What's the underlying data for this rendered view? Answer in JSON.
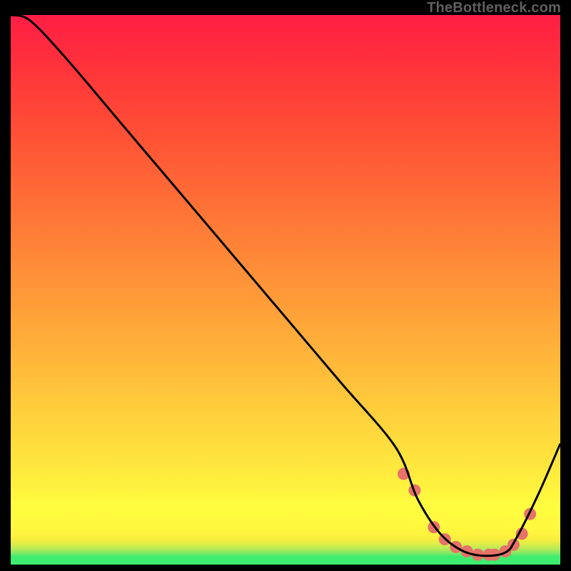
{
  "watermark": "TheBottleneck.com",
  "chart_data": {
    "type": "line",
    "title": "",
    "xlabel": "",
    "ylabel": "",
    "xlim": [
      0,
      100
    ],
    "ylim": [
      0,
      100
    ],
    "grid": false,
    "series": [
      {
        "name": "curve",
        "x": [
          0,
          3.5,
          10,
          20,
          30,
          40,
          50,
          60,
          70,
          74,
          78,
          82,
          86,
          90,
          92,
          96,
          100
        ],
        "y": [
          100,
          99,
          92.2,
          80.4,
          68.6,
          56.8,
          45,
          33.2,
          21.4,
          12,
          5.8,
          2.6,
          1.6,
          2.2,
          4.8,
          12.8,
          22
        ]
      }
    ],
    "markers": {
      "name": "dots",
      "x": [
        71.5,
        73.5,
        77,
        79,
        81,
        83,
        85,
        87,
        88,
        90,
        91.5,
        93,
        94.5
      ],
      "y": [
        16.5,
        13.5,
        6.8,
        4.6,
        3.2,
        2.4,
        1.8,
        1.8,
        1.8,
        2.4,
        3.6,
        5.6,
        9.2
      ]
    },
    "gradient_bands": [
      {
        "stop": 0.0,
        "color": "#3eed6e"
      },
      {
        "stop": 0.015,
        "color": "#3eed6e"
      },
      {
        "stop": 0.02,
        "color": "#7be868"
      },
      {
        "stop": 0.025,
        "color": "#9ee95d"
      },
      {
        "stop": 0.03,
        "color": "#bbeb56"
      },
      {
        "stop": 0.035,
        "color": "#d3ec4e"
      },
      {
        "stop": 0.04,
        "color": "#e6ee46"
      },
      {
        "stop": 0.045,
        "color": "#f2ee41"
      },
      {
        "stop": 0.05,
        "color": "#fdf03d"
      },
      {
        "stop": 0.06,
        "color": "#fef63e"
      },
      {
        "stop": 0.075,
        "color": "#fffa3f"
      },
      {
        "stop": 0.11,
        "color": "#fffc3f"
      },
      {
        "stop": 0.14,
        "color": "#fff23e"
      },
      {
        "stop": 0.2,
        "color": "#ffe23d"
      },
      {
        "stop": 0.3,
        "color": "#ffc93b"
      },
      {
        "stop": 0.4,
        "color": "#ffb03a"
      },
      {
        "stop": 0.5,
        "color": "#ff9738"
      },
      {
        "stop": 0.6,
        "color": "#ff7e37"
      },
      {
        "stop": 0.7,
        "color": "#ff6536"
      },
      {
        "stop": 0.8,
        "color": "#ff4c36"
      },
      {
        "stop": 0.9,
        "color": "#ff343b"
      },
      {
        "stop": 1.0,
        "color": "#ff1e45"
      }
    ]
  }
}
